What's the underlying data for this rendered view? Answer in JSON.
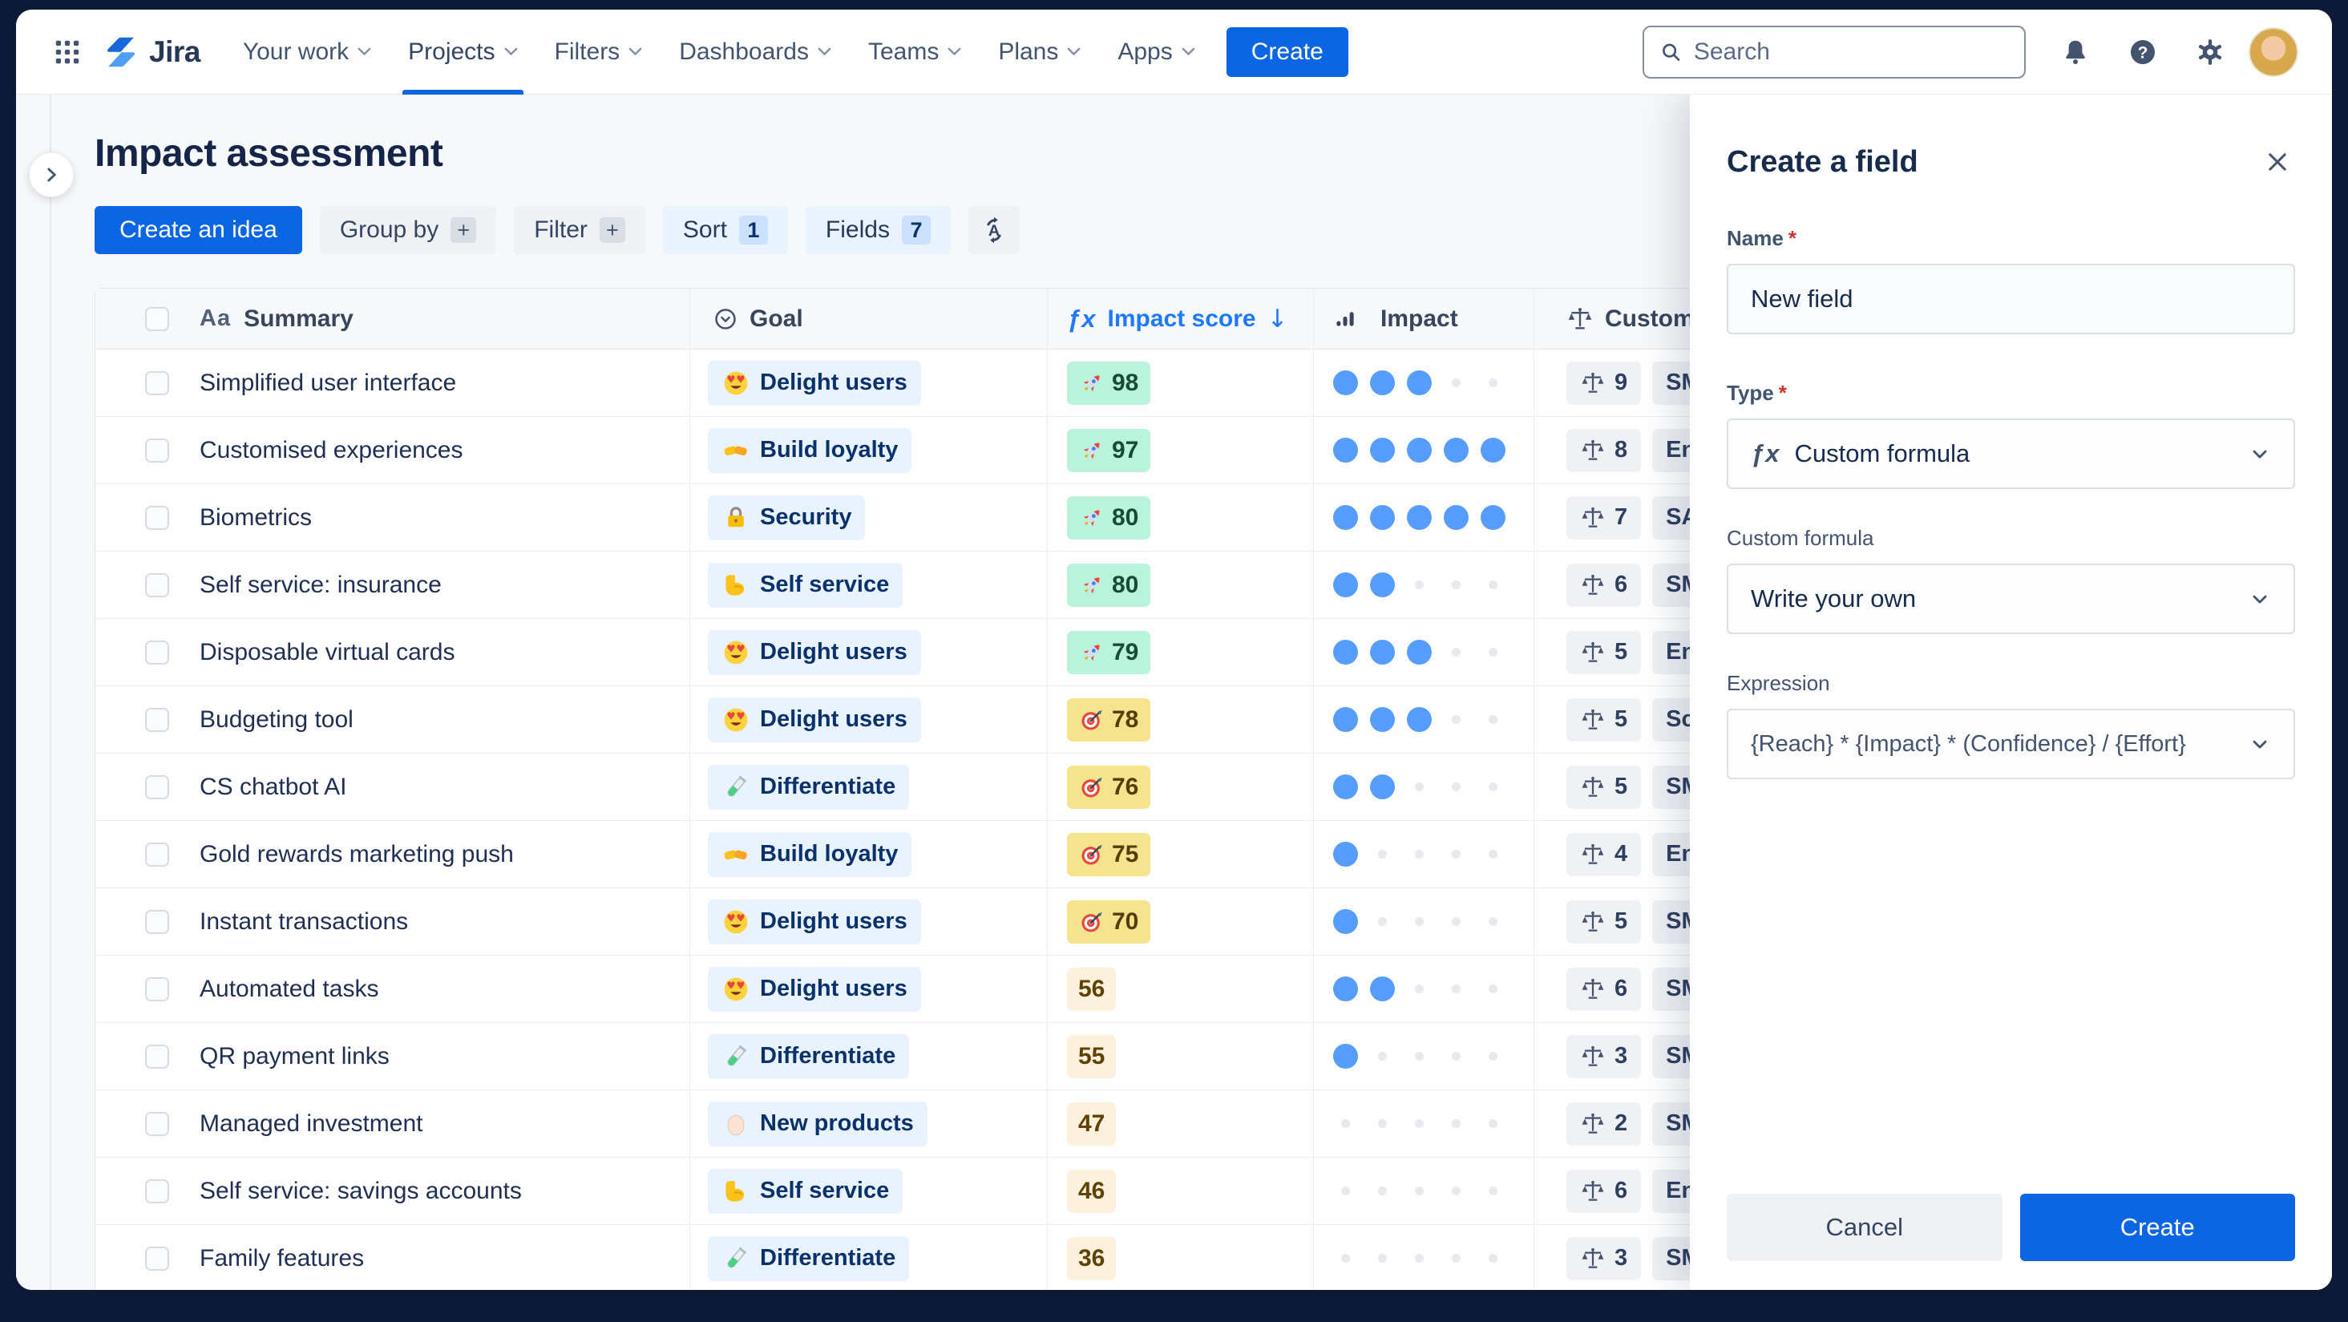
{
  "nav": {
    "logo_text": "Jira",
    "items": [
      {
        "label": "Your work",
        "active": false
      },
      {
        "label": "Projects",
        "active": true
      },
      {
        "label": "Filters",
        "active": false
      },
      {
        "label": "Dashboards",
        "active": false
      },
      {
        "label": "Teams",
        "active": false
      },
      {
        "label": "Plans",
        "active": false
      },
      {
        "label": "Apps",
        "active": false
      }
    ],
    "create_button": "Create",
    "search_placeholder": "Search"
  },
  "page": {
    "title": "Impact assessment",
    "toolbar": {
      "create_idea": "Create an idea",
      "group_by": "Group by",
      "group_by_plus": "+",
      "filter": "Filter",
      "filter_plus": "+",
      "sort": "Sort",
      "sort_count": "1",
      "fields": "Fields",
      "fields_count": "7"
    }
  },
  "table": {
    "headers": {
      "summary": "Summary",
      "summary_icon": "Aa",
      "goal": "Goal",
      "impact_score": "Impact score",
      "impact_score_fx": "ƒx",
      "impact_score_sort": "↓",
      "impact": "Impact",
      "customer": "Customer"
    },
    "rows": [
      {
        "summary": "Simplified user interface",
        "goal": "Delight users",
        "goal_icon": "heart-eyes",
        "score": "98",
        "score_style": "green",
        "score_icon": "rocket",
        "impact_dots": 3,
        "weight": "9",
        "segment": "SMB"
      },
      {
        "summary": "Customised experiences",
        "goal": "Build loyalty",
        "goal_icon": "handshake",
        "score": "97",
        "score_style": "green",
        "score_icon": "rocket",
        "impact_dots": 5,
        "weight": "8",
        "segment": "Enterprise"
      },
      {
        "summary": "Biometrics",
        "goal": "Security",
        "goal_icon": "lock",
        "score": "80",
        "score_style": "green",
        "score_icon": "rocket",
        "impact_dots": 5,
        "weight": "7",
        "segment": "SAAS"
      },
      {
        "summary": "Self service: insurance",
        "goal": "Self service",
        "goal_icon": "flex",
        "score": "80",
        "score_style": "green",
        "score_icon": "rocket",
        "impact_dots": 2,
        "weight": "6",
        "segment": "SMB"
      },
      {
        "summary": "Disposable virtual cards",
        "goal": "Delight users",
        "goal_icon": "heart-eyes",
        "score": "79",
        "score_style": "green",
        "score_icon": "rocket",
        "impact_dots": 3,
        "weight": "5",
        "segment": "Enterprise"
      },
      {
        "summary": "Budgeting tool",
        "goal": "Delight users",
        "goal_icon": "heart-eyes",
        "score": "78",
        "score_style": "yellow",
        "score_icon": "target",
        "impact_dots": 3,
        "weight": "5",
        "segment": "Scale"
      },
      {
        "summary": "CS chatbot AI",
        "goal": "Differentiate",
        "goal_icon": "test-tube",
        "score": "76",
        "score_style": "yellow",
        "score_icon": "target",
        "impact_dots": 2,
        "weight": "5",
        "segment": "SMB"
      },
      {
        "summary": "Gold rewards marketing push",
        "goal": "Build loyalty",
        "goal_icon": "handshake",
        "score": "75",
        "score_style": "yellow",
        "score_icon": "target",
        "impact_dots": 1,
        "weight": "4",
        "segment": "Enterprise"
      },
      {
        "summary": "Instant transactions",
        "goal": "Delight users",
        "goal_icon": "heart-eyes",
        "score": "70",
        "score_style": "yellow",
        "score_icon": "target",
        "impact_dots": 1,
        "weight": "5",
        "segment": "SMB"
      },
      {
        "summary": "Automated tasks",
        "goal": "Delight users",
        "goal_icon": "heart-eyes",
        "score": "56",
        "score_style": "plain",
        "score_icon": null,
        "impact_dots": 2,
        "weight": "6",
        "segment": "SMB"
      },
      {
        "summary": "QR payment links",
        "goal": "Differentiate",
        "goal_icon": "test-tube",
        "score": "55",
        "score_style": "plain",
        "score_icon": null,
        "impact_dots": 1,
        "weight": "3",
        "segment": "SMB"
      },
      {
        "summary": "Managed investment",
        "goal": "New products",
        "goal_icon": "egg",
        "score": "47",
        "score_style": "plain",
        "score_icon": null,
        "impact_dots": 0,
        "weight": "2",
        "segment": "SMB"
      },
      {
        "summary": "Self service: savings accounts",
        "goal": "Self service",
        "goal_icon": "flex",
        "score": "46",
        "score_style": "plain",
        "score_icon": null,
        "impact_dots": 0,
        "weight": "6",
        "segment": "Enterprise"
      },
      {
        "summary": "Family features",
        "goal": "Differentiate",
        "goal_icon": "test-tube",
        "score": "36",
        "score_style": "plain",
        "score_icon": null,
        "impact_dots": 0,
        "weight": "3",
        "segment": "SMB"
      }
    ]
  },
  "panel": {
    "title": "Create a field",
    "name_label": "Name",
    "name_value": "New field",
    "type_label": "Type",
    "type_fx": "ƒx",
    "type_value": "Custom formula",
    "custom_formula_label": "Custom formula",
    "custom_formula_value": "Write your own",
    "expression_label": "Expression",
    "expression_value": "{Reach} * {Impact} * (Confidence} / {Effort}",
    "cancel_button": "Cancel",
    "create_button": "Create"
  },
  "colors": {
    "brand_blue": "#0c66e4",
    "link_blue": "#1d7afc",
    "frame_navy": "#0c1a38",
    "score_green_bg": "#baf3db",
    "score_yellow_bg": "#f5e38d",
    "score_plain_bg": "#fdf0dc",
    "goal_badge_bg": "#e9f2ff",
    "impact_dot": "#579dff",
    "required_red": "#c9372c"
  }
}
